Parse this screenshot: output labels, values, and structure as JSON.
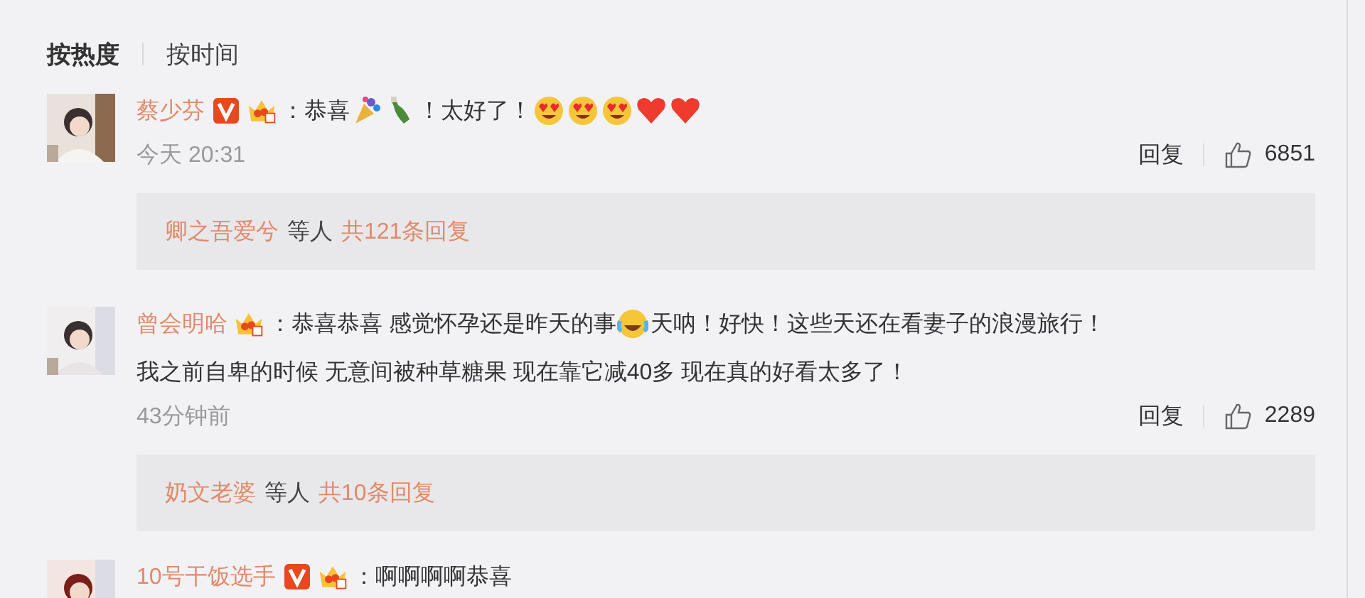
{
  "sort_tabs": [
    {
      "label": "按热度",
      "selected": true
    },
    {
      "label": "按时间",
      "selected": false
    }
  ],
  "comments": [
    {
      "name": "蔡少芬",
      "verified": true,
      "member": true,
      "lines": [
        [
          {
            "kind": "text",
            "text": "：恭喜"
          },
          {
            "kind": "party"
          },
          {
            "kind": "bottle"
          },
          {
            "kind": "text",
            "text": "！太好了！"
          },
          {
            "kind": "heart-eyes"
          },
          {
            "kind": "heart-eyes"
          },
          {
            "kind": "heart-eyes"
          },
          {
            "kind": "heart"
          },
          {
            "kind": "heart"
          }
        ]
      ],
      "time": "今天 20:31",
      "reply": "回复",
      "likes": "6851",
      "replies": {
        "users": "卿之吾爱兮",
        "middle": "等人",
        "total": "共121条回复"
      }
    },
    {
      "name": "曾会明哈",
      "verified": false,
      "member": true,
      "lines": [
        [
          {
            "kind": "text",
            "text": "：恭喜恭喜 感觉怀孕还是昨天的事"
          },
          {
            "kind": "laugh-cry"
          },
          {
            "kind": "text",
            "text": "天呐！好快！这些天还在看妻子的浪漫旅行！"
          }
        ],
        [
          {
            "kind": "text",
            "text": "我之前自卑的时候 无意间被种草糖果 现在靠它减40多 现在真的好看太多了！"
          }
        ]
      ],
      "time": "43分钟前",
      "reply": "回复",
      "likes": "2289",
      "replies": {
        "users": "奶文老婆",
        "middle": "等人",
        "total": "共10条回复"
      }
    },
    {
      "name": "10号干饭选手",
      "verified": true,
      "member": true,
      "lines": [
        [
          {
            "kind": "text",
            "text": "：啊啊啊啊恭喜"
          }
        ]
      ]
    }
  ]
}
